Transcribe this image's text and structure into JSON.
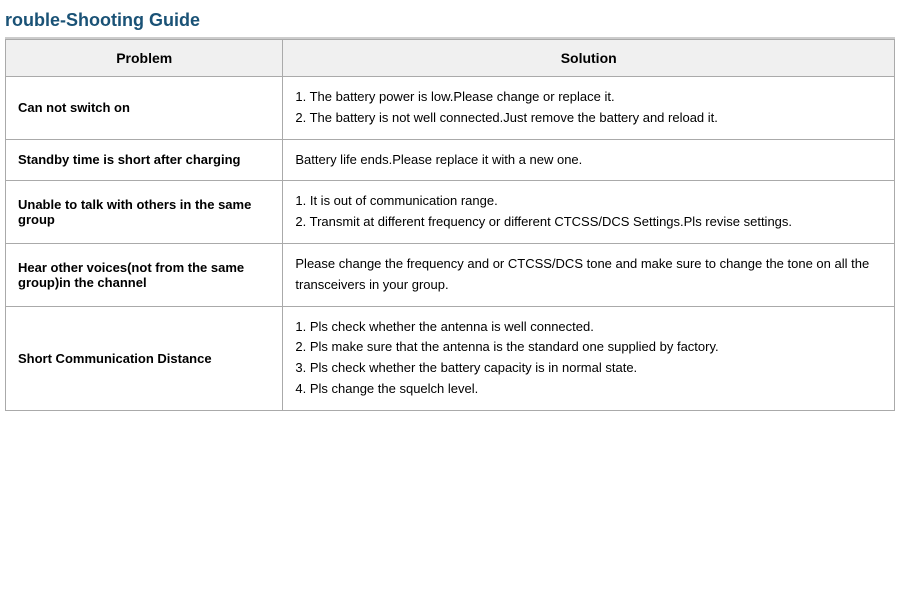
{
  "title": "rouble-Shooting Guide",
  "table": {
    "header": {
      "problem": "Problem",
      "solution": "Solution"
    },
    "rows": [
      {
        "problem": "Can not switch on",
        "solution": "1. The battery power is low.Please change or replace it.\n2. The battery is not well connected.Just remove the battery and reload it."
      },
      {
        "problem": "Standby time is short after charging",
        "solution": "Battery life ends.Please replace it with a new one."
      },
      {
        "problem": "Unable to talk with others in the same group",
        "solution": "1. It is out of communication range.\n2. Transmit at different frequency or different CTCSS/DCS Settings.Pls revise settings."
      },
      {
        "problem": "Hear other voices(not from the same group)in the channel",
        "solution": "Please change the frequency and or CTCSS/DCS tone and make sure to change the tone on all the transceivers in your group."
      },
      {
        "problem": "Short Communication Distance",
        "solution": "1. Pls check whether the antenna is well connected.\n2. Pls make sure that the antenna is the standard one supplied by factory.\n3. Pls check whether the battery capacity is in normal state.\n4. Pls change the squelch level."
      }
    ]
  }
}
